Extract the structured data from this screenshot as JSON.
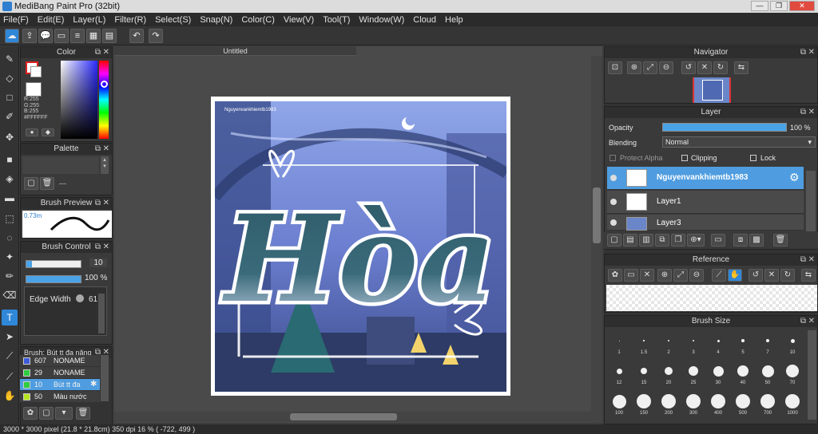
{
  "window": {
    "title": "MediBang Paint Pro (32bit)"
  },
  "menu": [
    "File(F)",
    "Edit(E)",
    "Layer(L)",
    "Filter(R)",
    "Select(S)",
    "Snap(N)",
    "Color(C)",
    "View(V)",
    "Tool(T)",
    "Window(W)",
    "Cloud",
    "Help"
  ],
  "document": {
    "tab_title": "Untitled"
  },
  "status": {
    "text": "3000 * 3000 pixel  (21.8 * 21.8cm)  350 dpi  16 %  ( -722, 499 )"
  },
  "color_panel": {
    "title": "Color",
    "r": "R:255",
    "g": "G:255",
    "b": "B:255",
    "hex": "#FFFFFF"
  },
  "palette_panel": {
    "title": "Palette",
    "dash": "---"
  },
  "brush_preview": {
    "title": "Brush Preview",
    "size": "0.73m"
  },
  "brush_control": {
    "title": "Brush Control",
    "size_value": "10",
    "opacity_value": "100 %",
    "opacity_fraction": 1.0,
    "size_fraction": 0.1,
    "edge_label": "Edge Width",
    "edge_value": "61"
  },
  "brush_list": {
    "title": "Brush: Bút tt đa năng",
    "items": [
      {
        "n": "607",
        "label": "NONAME",
        "color": "#3b5bdb"
      },
      {
        "n": "29",
        "label": "NONAME",
        "color": "#2ecc40"
      },
      {
        "n": "10",
        "label": "Bút tt đa",
        "color": "#2ecc40"
      },
      {
        "n": "50",
        "label": "Màu nước",
        "color": "#b5e61d"
      }
    ]
  },
  "navigator": {
    "title": "Navigator"
  },
  "layer_panel": {
    "title": "Layer",
    "opacity_label": "Opacity",
    "opacity_value": "100 %",
    "opacity_fraction": 1.0,
    "blending_label": "Blending",
    "blending_value": "Normal",
    "protect_alpha": "Protect Alpha",
    "clipping": "Clipping",
    "lock": "Lock",
    "layers": [
      {
        "name": "Nguyenvankhiemtb1983",
        "selected": true
      },
      {
        "name": "Layer1",
        "selected": false
      },
      {
        "name": "Layer3",
        "selected": false
      }
    ]
  },
  "reference": {
    "title": "Reference"
  },
  "brush_size": {
    "title": "Brush Size",
    "sizes": [
      "1",
      "1.5",
      "2",
      "3",
      "4",
      "5",
      "7",
      "10",
      "12",
      "15",
      "20",
      "25",
      "30",
      "40",
      "50",
      "70",
      "100",
      "150",
      "200",
      "300",
      "400",
      "500",
      "700",
      "1000"
    ]
  },
  "artwork": {
    "text": "Hòa",
    "watermark": "Nguyenvankhiemtb1983"
  }
}
